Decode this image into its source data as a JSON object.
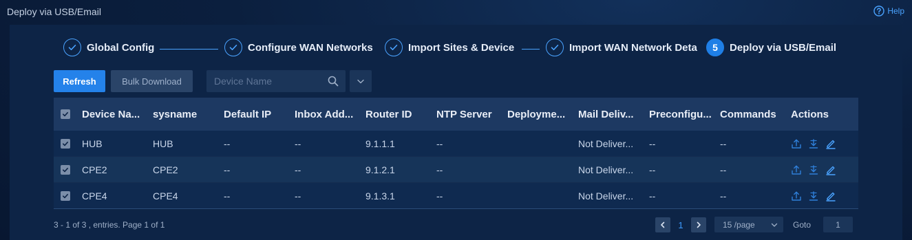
{
  "window": {
    "title": "Deploy via USB/Email",
    "help_label": "Help"
  },
  "steps": [
    {
      "label": "Global Config",
      "state": "done"
    },
    {
      "label": "Configure WAN Networks",
      "state": "done"
    },
    {
      "label": "Import Sites & Device",
      "state": "done"
    },
    {
      "label": "Import WAN Network Deta",
      "state": "done"
    },
    {
      "label": "Deploy via USB/Email",
      "state": "active",
      "number": "5"
    }
  ],
  "toolbar": {
    "refresh_label": "Refresh",
    "bulk_download_label": "Bulk Download",
    "search_placeholder": "Device Name"
  },
  "table": {
    "columns": [
      "Device Na...",
      "sysname",
      "Default IP",
      "Inbox Add...",
      "Router ID",
      "NTP Server",
      "Deployme...",
      "Mail Deliv...",
      "Preconfigu...",
      "Commands",
      "Actions"
    ],
    "rows": [
      {
        "checked": true,
        "cells": [
          "HUB",
          "HUB",
          "--",
          "--",
          "9.1.1.1",
          "--",
          "",
          "Not Deliver...",
          "--",
          "--"
        ]
      },
      {
        "checked": true,
        "cells": [
          "CPE2",
          "CPE2",
          "--",
          "--",
          "9.1.2.1",
          "--",
          "",
          "Not Deliver...",
          "--",
          "--"
        ]
      },
      {
        "checked": true,
        "cells": [
          "CPE4",
          "CPE4",
          "--",
          "--",
          "9.1.3.1",
          "--",
          "",
          "Not Deliver...",
          "--",
          "--"
        ]
      }
    ],
    "action_icons": [
      "upload-icon",
      "download-icon",
      "edit-icon"
    ]
  },
  "footer": {
    "info": "3 - 1 of 3 , entries. Page 1 of 1",
    "current_page": "1",
    "page_size": "15 /page",
    "goto_label": "Goto",
    "goto_value": "1"
  },
  "colors": {
    "accent": "#2482ea",
    "link": "#4aa3ff",
    "background": "#0d2446"
  }
}
